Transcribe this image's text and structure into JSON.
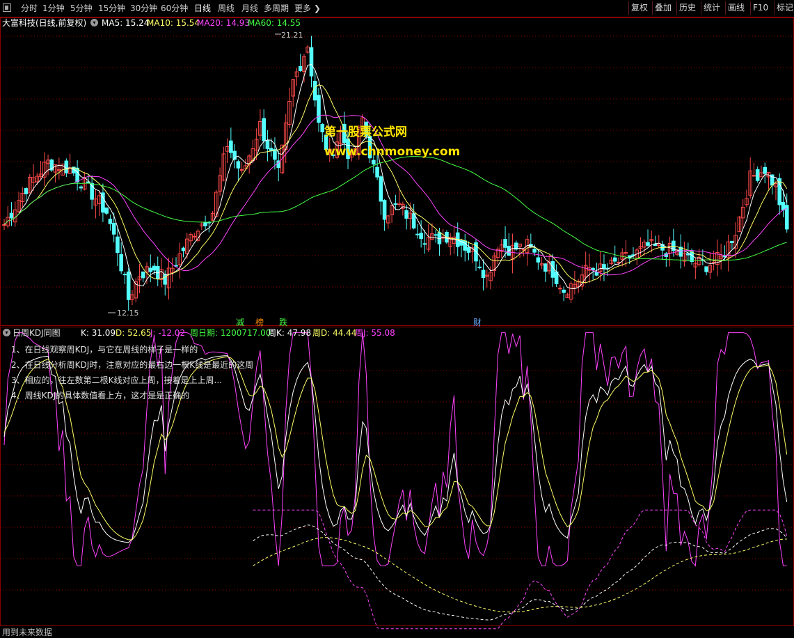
{
  "toolbar": {
    "periods": [
      "分时",
      "1分钟",
      "5分钟",
      "15分钟",
      "30分钟",
      "60分钟",
      "日线",
      "周线",
      "月线",
      "多周期",
      "更多"
    ],
    "active_period": "日线",
    "right_buttons": [
      "复权",
      "叠加",
      "历史",
      "统计",
      "画线",
      "F10",
      "标记"
    ]
  },
  "main_chart": {
    "title": "大富科技(日线,前复权)",
    "ma": [
      {
        "label": "MA5: 15.24",
        "color": "#ffffff"
      },
      {
        "label": "MA10: 15.54",
        "color": "#ffff66"
      },
      {
        "label": "MA20: 14.93",
        "color": "#ff44ff"
      },
      {
        "label": "MA60: 14.55",
        "color": "#44ff44"
      }
    ],
    "high_label": "21.21",
    "low_label": "12.15",
    "events": [
      {
        "text": "减",
        "color": "#44ff44"
      },
      {
        "text": "榜",
        "color": "#ff8800"
      },
      {
        "text": "跌",
        "color": "#44ff44"
      },
      {
        "text": "财",
        "color": "#66aaff"
      }
    ]
  },
  "watermark": {
    "title": "第一股票公式网",
    "url": "www.chnmoney.com"
  },
  "kdj_panel": {
    "title": "日周KDJ同图",
    "values": [
      {
        "label": "K: 31.09",
        "color": "#ffffff"
      },
      {
        "label": "D: 52.65",
        "color": "#ffff66"
      },
      {
        "label": "J: -12.02",
        "color": "#ff44ff"
      },
      {
        "label": "周日期: 1200717.00",
        "color": "#44ff44"
      },
      {
        "label": "周K: 47.98",
        "color": "#ffffff"
      },
      {
        "label": "周D: 44.44",
        "color": "#ffff66"
      },
      {
        "label": "周J: 55.08",
        "color": "#ff44ff"
      }
    ],
    "notes": [
      "1、在日线观察周KDJ，与它在周线的样子是一样的",
      "2、在日线分析周KDJ时，注意对应的最右边一根K线是最近的这周",
      "3、相应的，往左数第二根K线对应上周，接着是上上周...",
      "4、周线KDJ的具体数值看上方，这才是是正确的"
    ]
  },
  "footer": {
    "status": "用到未来数据"
  },
  "colors": {
    "up": "#ff4a4a",
    "down": "#54ffff",
    "grid": "#8b0000"
  }
}
